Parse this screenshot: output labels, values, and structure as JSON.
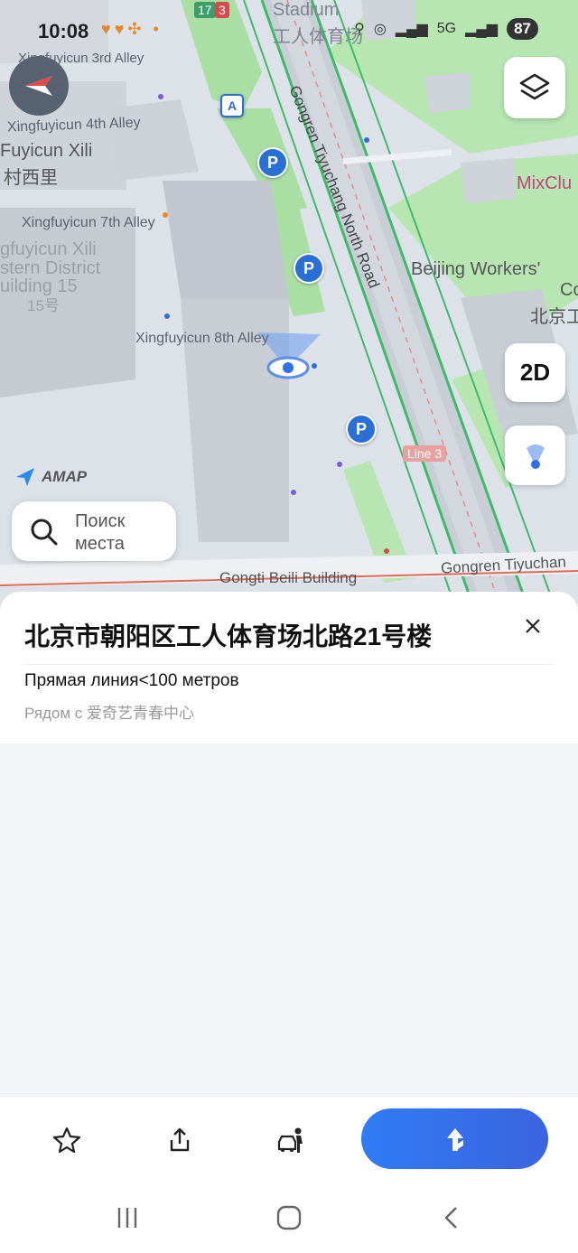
{
  "status_bar": {
    "time": "10:08",
    "network": "5G",
    "battery": "87"
  },
  "map": {
    "labels": {
      "stadium_en": "Stadium",
      "stadium_zh": "工人体育场",
      "xf3": "Xingfuyicun 3rd Alley",
      "xf4": "Xingfuyicun 4th Alley",
      "xili": "Fuyicun Xili",
      "xili_zh": "村西里",
      "xf7": "Xingfuyicun 7th Alley",
      "xili2": "gfuyicun Xili",
      "district": "stern District",
      "building15": "uilding 15",
      "num15": "15号",
      "xf8": "Xingfuyicun 8th Alley",
      "gongren_road": "Gongren Tiyuchang North Road",
      "workers": "Beijing Workers'",
      "workers2": "Co",
      "workers_zh": "北京工",
      "mixclub": "MixClu",
      "line3": "Line 3",
      "gongti": "Gongti Beili Building",
      "gongren2": "Gongren Tiyuchan",
      "metro_17": "17",
      "metro_3": "3",
      "a": "A",
      "parking": "P"
    },
    "buttons": {
      "view_2d": "2D"
    },
    "logo": "AMAP",
    "search_placeholder": "Поиск места"
  },
  "place": {
    "title": "北京市朝阳区工人体育场北路21号楼",
    "distance": "Прямая линия<100 метров",
    "nearby": "Рядом с 爱奇艺青春中心"
  },
  "colors": {
    "accent": "#2f6fe8",
    "road_green": "#3dbb6b",
    "park": "#a7e0a7"
  }
}
